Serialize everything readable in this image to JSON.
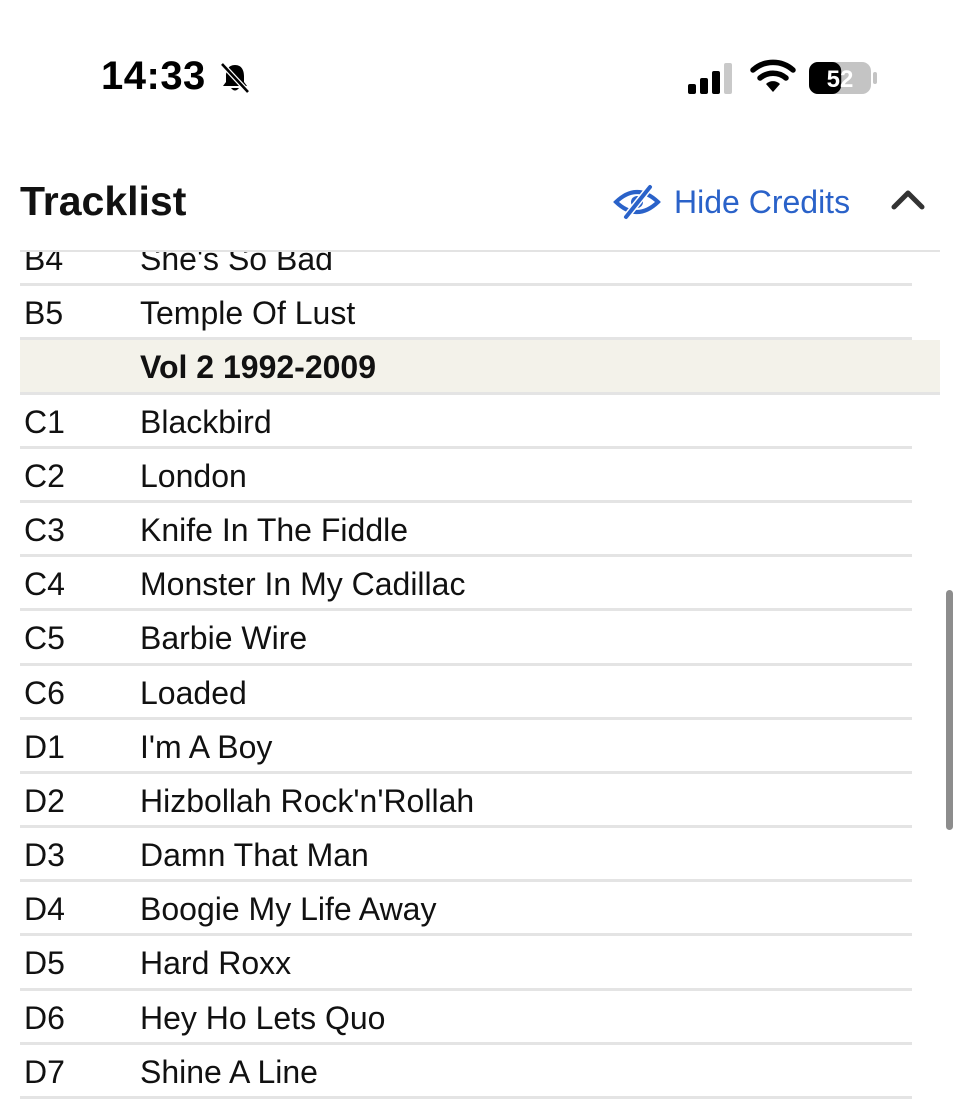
{
  "status_bar": {
    "time": "14:33",
    "silent_icon": "bell-slash-icon",
    "signal_icon": "cellular-signal-icon",
    "wifi_icon": "wifi-icon",
    "battery_percent": "52",
    "battery_level": 0.52
  },
  "header": {
    "title": "Tracklist",
    "credits_label": "Hide Credits",
    "credits_icon": "eye-slash-icon",
    "collapse_icon": "chevron-up-icon"
  },
  "colors": {
    "accent": "#2a62c9",
    "heading_row_bg": "#f3f2ea",
    "divider": "#e4e4e4"
  },
  "tracks": [
    {
      "position": "B4",
      "title": "She's So Bad",
      "heading": false
    },
    {
      "position": "B5",
      "title": "Temple Of Lust",
      "heading": false
    },
    {
      "position": "",
      "title": "Vol 2 1992-2009",
      "heading": true
    },
    {
      "position": "C1",
      "title": "Blackbird",
      "heading": false
    },
    {
      "position": "C2",
      "title": "London",
      "heading": false
    },
    {
      "position": "C3",
      "title": "Knife In The Fiddle",
      "heading": false
    },
    {
      "position": "C4",
      "title": "Monster In My Cadillac",
      "heading": false
    },
    {
      "position": "C5",
      "title": "Barbie Wire",
      "heading": false
    },
    {
      "position": "C6",
      "title": "Loaded",
      "heading": false
    },
    {
      "position": "D1",
      "title": "I'm A Boy",
      "heading": false
    },
    {
      "position": "D2",
      "title": "Hizbollah Rock'n'Rollah",
      "heading": false
    },
    {
      "position": "D3",
      "title": "Damn That Man",
      "heading": false
    },
    {
      "position": "D4",
      "title": "Boogie My Life Away",
      "heading": false
    },
    {
      "position": "D5",
      "title": "Hard Roxx",
      "heading": false
    },
    {
      "position": "D6",
      "title": "Hey Ho Lets Quo",
      "heading": false
    },
    {
      "position": "D7",
      "title": "Shine A Line",
      "heading": false
    }
  ]
}
